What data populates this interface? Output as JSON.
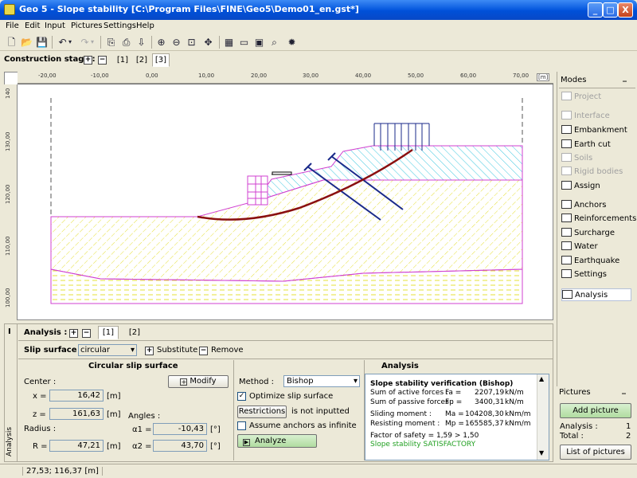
{
  "window": {
    "title": "Geo 5 - Slope stability [C:\\Program Files\\FINE\\Geo5\\Demo01_en.gst*]",
    "min": "_",
    "max": "□",
    "close": "X"
  },
  "menu": [
    "File",
    "Edit",
    "Input",
    "Pictures",
    "Settings",
    "Help"
  ],
  "stage": {
    "label": "Construction stage :",
    "tabs": [
      "[1]",
      "[2]",
      "[3]"
    ],
    "selected": 2
  },
  "ruler": {
    "x_ticks": [
      "-20,00",
      "-10,00",
      "0,00",
      "10,00",
      "20,00",
      "30,00",
      "40,00",
      "50,00",
      "60,00",
      "70,00"
    ],
    "x_unit": "[m]",
    "y_ticks": [
      "140",
      "130,00",
      "120,00",
      "110,00",
      "100,00"
    ]
  },
  "modes": {
    "title": "Modes",
    "items": [
      {
        "label": "Project",
        "enabled": false
      },
      {
        "label": "Interface",
        "enabled": false
      },
      {
        "label": "Embankment",
        "enabled": true
      },
      {
        "label": "Earth cut",
        "enabled": true
      },
      {
        "label": "Soils",
        "enabled": false
      },
      {
        "label": "Rigid bodies",
        "enabled": false
      },
      {
        "label": "Assign",
        "enabled": true
      },
      {
        "label": "Anchors",
        "enabled": true
      },
      {
        "label": "Reinforcements",
        "enabled": true
      },
      {
        "label": "Surcharge",
        "enabled": true
      },
      {
        "label": "Water",
        "enabled": true
      },
      {
        "label": "Earthquake",
        "enabled": true
      },
      {
        "label": "Settings",
        "enabled": true
      },
      {
        "label": "Analysis",
        "enabled": true,
        "active": true
      }
    ]
  },
  "pictures": {
    "title": "Pictures",
    "add": "Add picture",
    "analysis_label": "Analysis :",
    "analysis_count": "1",
    "total_label": "Total :",
    "total_count": "2",
    "list": "List of pictures"
  },
  "analysis": {
    "label": "Analysis :",
    "tabs": [
      "[1]",
      "[2]"
    ],
    "selected": 0,
    "slip_label": "Slip surface :",
    "slip_value": "circular",
    "substitute": "Substitute",
    "remove": "Remove",
    "vertical_tab": "Analysis",
    "circ_title": "Circular slip surface",
    "center_label": "Center :",
    "modify": "Modify",
    "x_label": "x =",
    "x_value": "16,42",
    "z_label": "z =",
    "z_value": "161,63",
    "unit_m": "[m]",
    "angles_label": "Angles :",
    "a1_label": "α1 =",
    "a1_value": "-10,43",
    "a2_label": "α2 =",
    "a2_value": "43,70",
    "unit_deg": "[°]",
    "radius_label": "Radius :",
    "r_label": "R =",
    "r_value": "47,21",
    "method_label": "Method :",
    "method_value": "Bishop",
    "optimize": "Optimize slip surface",
    "optimize_checked": true,
    "restrictions": "Restrictions",
    "restrictions_status": "is not inputted",
    "anchors_inf": "Assume anchors as infinite",
    "anchors_checked": false,
    "analyze": "Analyze",
    "results_title": "Analysis",
    "results": {
      "heading": "Slope stability verification (Bishop)",
      "active_label": "Sum of active forces :",
      "active_sym": "Fa =",
      "active_val": "2207,19",
      "force_unit": "kN/m",
      "passive_label": "Sum of passive forces :",
      "passive_sym": "Fp =",
      "passive_val": "3400,31",
      "sliding_label": "Sliding moment :",
      "sliding_sym": "Ma =",
      "sliding_val": "104208,30",
      "moment_unit": "kNm/m",
      "resisting_label": "Resisting moment :",
      "resisting_sym": "Mp =",
      "resisting_val": "165585,37",
      "fos": "Factor of safety = 1,59 > 1,50",
      "verdict": "Slope stability SATISFACTORY",
      "verdict_color": "#22a022"
    }
  },
  "status": {
    "coords": "27,53; 116,37 [m]"
  }
}
